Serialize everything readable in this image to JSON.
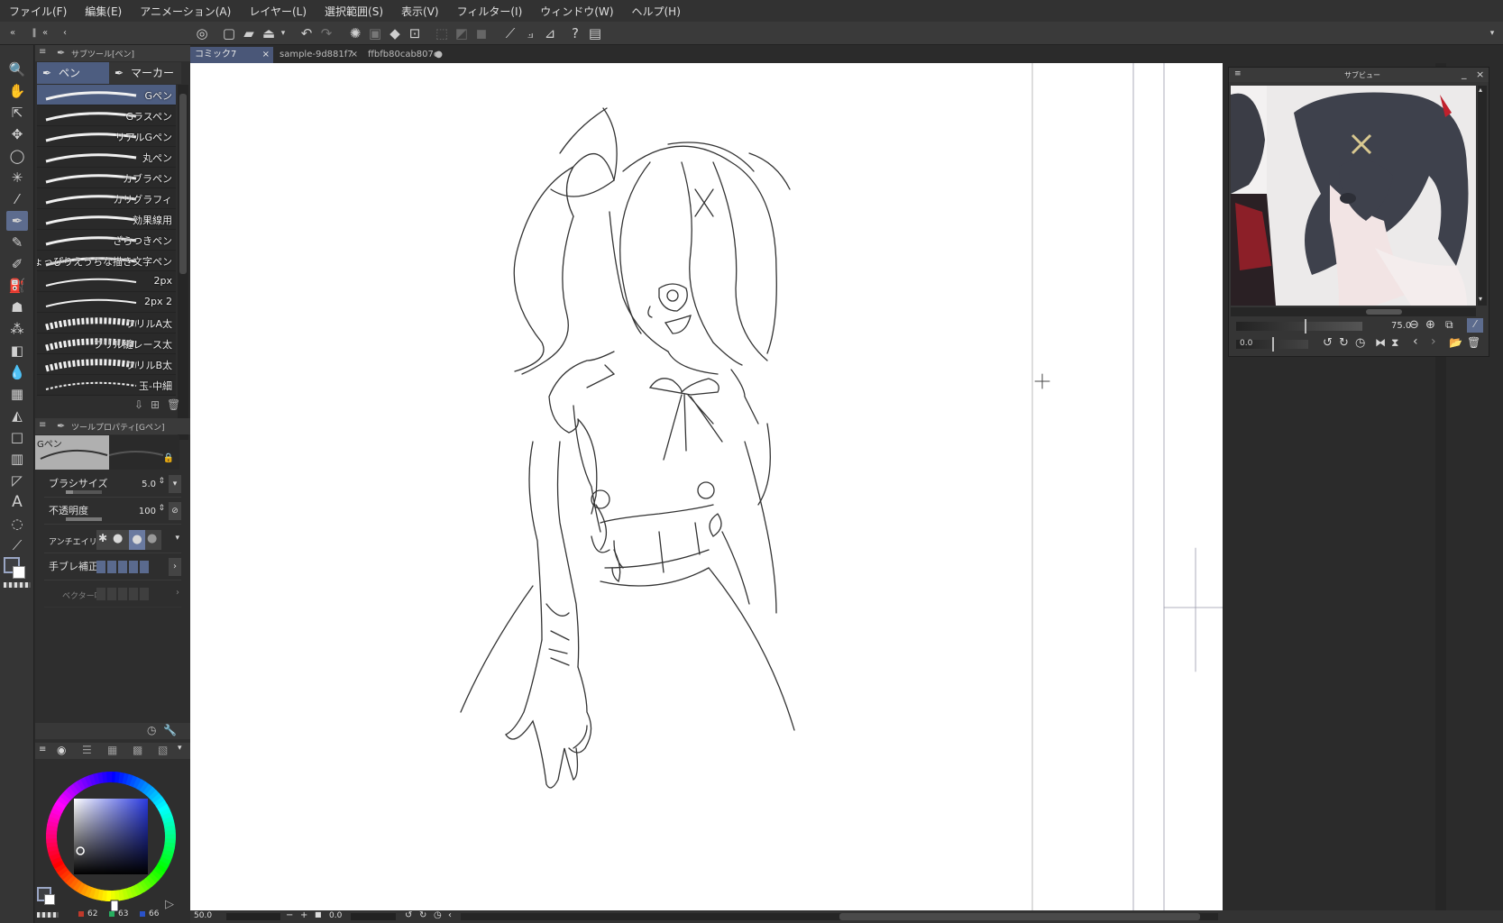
{
  "menu": [
    "ファイル(F)",
    "編集(E)",
    "アニメーション(A)",
    "レイヤー(L)",
    "選択範囲(S)",
    "表示(V)",
    "フィルター(I)",
    "ウィンドウ(W)",
    "ヘルプ(H)"
  ],
  "subtool_panel": {
    "title": "サブツール[ペン]",
    "tabs": [
      "ペン",
      "マーカー"
    ],
    "brushes": [
      "Gペン",
      "Gラスペン",
      "リアルGペン",
      "丸ペン",
      "カブラペン",
      "カリグラフィ",
      "効果線用",
      "ざらつきペン",
      "ちょっぴりえうちな描き文字ペン",
      "2px",
      "2px 2",
      "フリルA太",
      "フリル縫レース太",
      "フリルB太",
      "玉-中細"
    ]
  },
  "tool_property": {
    "title": "ツールプロパティ[Gペン]",
    "preview_label": "Gペン",
    "brush_size_label": "ブラシサイズ",
    "brush_size_value": "5.0",
    "opacity_label": "不透明度",
    "opacity_value": "100",
    "antialias_label": "アンチエイリアス",
    "stabilization_label": "手ブレ補正",
    "vector_label": "ベクター吸"
  },
  "color": {
    "r": "62",
    "g": "63",
    "b": "66",
    "main": "#3e3f42",
    "sub": "#ffffff",
    "wheel_sat": 0.62,
    "wheel_val": 0.25
  },
  "tabs": [
    {
      "label": "コミック7",
      "active": true
    },
    {
      "label": "sample-9d881f7",
      "active": false
    },
    {
      "label": "ffbfb80cab807e",
      "active": false
    }
  ],
  "subview": {
    "title": "サブビュー",
    "zoom": "75.0",
    "rotation": "0.0"
  },
  "status": {
    "zoom": "50.0",
    "rotation": "0.0"
  }
}
